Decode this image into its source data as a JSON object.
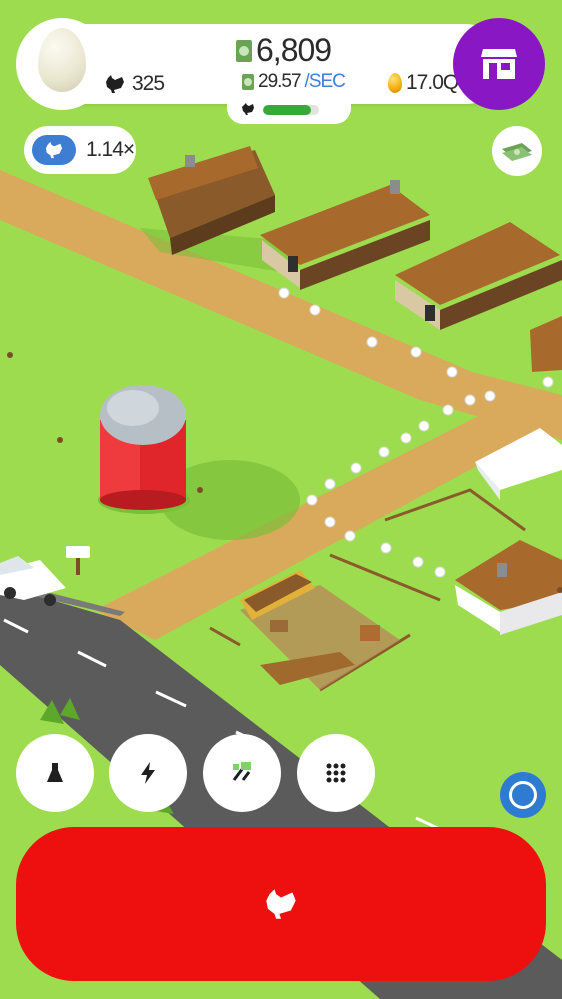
{
  "hud": {
    "money": "6,809",
    "income_rate": "29.57",
    "income_unit": "/SEC",
    "chicken_count": "325",
    "golden_eggs": "17.0Q",
    "hatch_progress_fraction": 0.85
  },
  "boost": {
    "multiplier": "1.14×"
  },
  "icons": {
    "egg": "egg-icon",
    "money": "money-icon",
    "chicken": "chicken-icon",
    "golden_egg": "golden-egg-icon",
    "shop": "shop-icon",
    "cash": "cash-stack-icon",
    "research": "flask-icon",
    "boost": "lightning-icon",
    "epic": "syringe-icon",
    "menu": "grid-icon",
    "hatch": "chicken-icon"
  },
  "colors": {
    "grass": "#9ddc4e",
    "road_dirt": "#d9a95c",
    "shop": "#8a17c4",
    "hatch_button": "#ee0f0f",
    "boost": "#3d7ed3",
    "progress": "#39a83b"
  }
}
